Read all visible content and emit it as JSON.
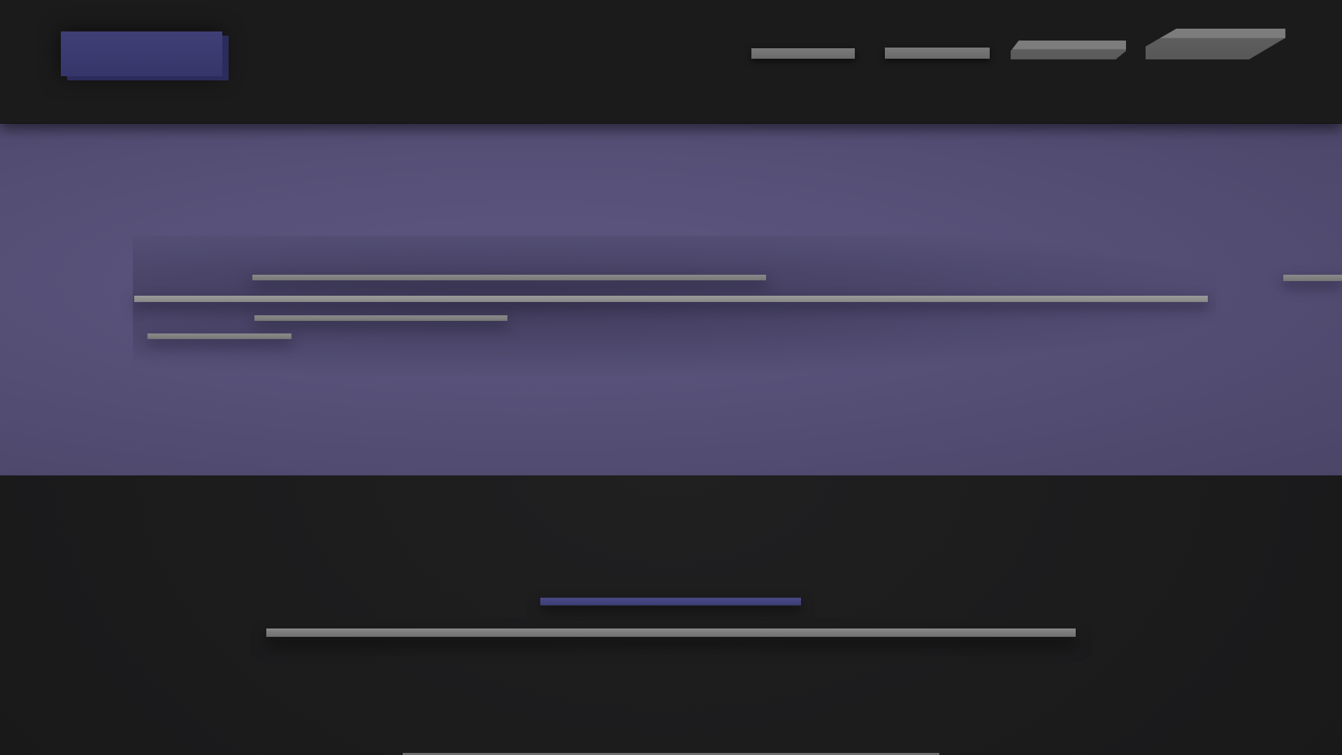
{
  "app": {
    "title": ""
  },
  "header": {
    "logo": {
      "label": ""
    },
    "nav": [
      {
        "label": ""
      },
      {
        "label": ""
      },
      {
        "label": ""
      },
      {
        "label": ""
      }
    ]
  },
  "hero": {
    "lines": [
      "",
      "",
      "",
      "",
      ""
    ]
  },
  "section": {
    "accent": "",
    "line": "",
    "line2": ""
  },
  "colors": {
    "background": "#1b1b1c",
    "hero": "#575179",
    "accent": "#3c3c74",
    "placeholder": "#7a7a7a"
  }
}
